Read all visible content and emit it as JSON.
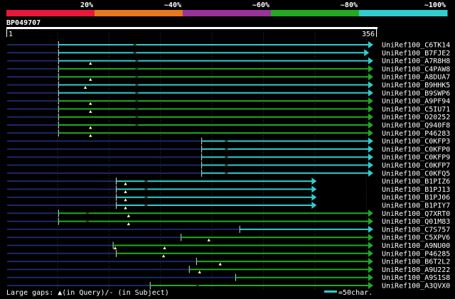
{
  "query_id": "BP049707",
  "legend_text": "Large gaps: ▲(in Query)/- (in Subject)",
  "scale_text": "=50char.",
  "colors": {
    "background": "#000000",
    "blue": "#33cccc",
    "green": "#22aa22",
    "navy": "#1a2a66",
    "red": "#e8183a",
    "orange": "#e8781e",
    "purple": "#993399"
  },
  "chart_data": {
    "type": "alignment",
    "query_start": 1,
    "query_end": 356,
    "identity_bands": [
      {
        "label": "20%",
        "color": "#e8183a"
      },
      {
        "label": "~40%",
        "color": "#e8781e"
      },
      {
        "label": "~60%",
        "color": "#993399"
      },
      {
        "label": "~80%",
        "color": "#22aa22"
      },
      {
        "label": "~100%",
        "color": "#33cccc"
      }
    ],
    "hits": [
      {
        "name": "UniRef100_C6TK14",
        "start": 51,
        "end": 356,
        "color": "blue",
        "marks": [
          {
            "pos": 125,
            "type": "gap_subject"
          }
        ]
      },
      {
        "name": "UniRef100_B7FJE2",
        "start": 51,
        "end": 352,
        "color": "blue",
        "marks": [
          {
            "pos": 125,
            "type": "gap_subject"
          }
        ]
      },
      {
        "name": "UniRef100_A7R8H8",
        "start": 51,
        "end": 356,
        "color": "blue",
        "marks": [
          {
            "pos": 82,
            "type": "gap_query"
          },
          {
            "pos": 127,
            "type": "gap_subject"
          }
        ]
      },
      {
        "name": "UniRef100_C4PAW8",
        "start": 51,
        "end": 356,
        "color": "green",
        "marks": [
          {
            "pos": 127,
            "type": "gap_subject"
          }
        ]
      },
      {
        "name": "UniRef100_A8DUA7",
        "start": 51,
        "end": 356,
        "color": "green",
        "marks": [
          {
            "pos": 82,
            "type": "gap_query"
          },
          {
            "pos": 127,
            "type": "gap_subject"
          }
        ]
      },
      {
        "name": "UniRef100_B9HHK5",
        "start": 51,
        "end": 356,
        "color": "blue",
        "marks": [
          {
            "pos": 77,
            "type": "gap_query"
          },
          {
            "pos": 127,
            "type": "gap_subject"
          }
        ]
      },
      {
        "name": "UniRef100_B9SWP6",
        "start": 51,
        "end": 356,
        "color": "blue",
        "marks": [
          {
            "pos": 127,
            "type": "gap_subject"
          }
        ]
      },
      {
        "name": "UniRef100_A9PF94",
        "start": 51,
        "end": 356,
        "color": "green",
        "marks": [
          {
            "pos": 82,
            "type": "gap_query"
          },
          {
            "pos": 127,
            "type": "gap_subject"
          }
        ]
      },
      {
        "name": "UniRef100_C5IU71",
        "start": 51,
        "end": 356,
        "color": "green",
        "marks": [
          {
            "pos": 82,
            "type": "gap_query"
          },
          {
            "pos": 127,
            "type": "gap_subject"
          }
        ]
      },
      {
        "name": "UniRef100_O20252",
        "start": 51,
        "end": 356,
        "color": "green",
        "marks": [
          {
            "pos": 127,
            "type": "gap_subject"
          }
        ]
      },
      {
        "name": "UniRef100_Q940F8",
        "start": 51,
        "end": 356,
        "color": "green",
        "marks": [
          {
            "pos": 82,
            "type": "gap_query"
          },
          {
            "pos": 127,
            "type": "gap_subject"
          }
        ]
      },
      {
        "name": "UniRef100_P46283",
        "start": 51,
        "end": 356,
        "color": "green",
        "marks": [
          {
            "pos": 82,
            "type": "gap_query"
          }
        ]
      },
      {
        "name": "UniRef100_C0KFP3",
        "start": 190,
        "end": 356,
        "color": "blue",
        "marks": [
          {
            "pos": 214,
            "type": "gap_subject"
          }
        ]
      },
      {
        "name": "UniRef100_C0KFP0",
        "start": 190,
        "end": 356,
        "color": "blue",
        "marks": [
          {
            "pos": 214,
            "type": "gap_subject"
          }
        ]
      },
      {
        "name": "UniRef100_C0KFP9",
        "start": 190,
        "end": 356,
        "color": "blue",
        "marks": [
          {
            "pos": 214,
            "type": "gap_subject"
          }
        ]
      },
      {
        "name": "UniRef100_C0KFP7",
        "start": 190,
        "end": 356,
        "color": "blue",
        "marks": [
          {
            "pos": 214,
            "type": "gap_subject"
          }
        ]
      },
      {
        "name": "UniRef100_C0KFQ5",
        "start": 190,
        "end": 356,
        "color": "blue",
        "marks": [
          {
            "pos": 214,
            "type": "gap_subject"
          }
        ]
      },
      {
        "name": "UniRef100_B1PIZ6",
        "start": 107,
        "end": 301,
        "color": "blue",
        "marks": [
          {
            "pos": 116,
            "type": "gap_query"
          },
          {
            "pos": 136,
            "type": "gap_subject"
          }
        ]
      },
      {
        "name": "UniRef100_B1PJ13",
        "start": 107,
        "end": 301,
        "color": "blue",
        "marks": [
          {
            "pos": 116,
            "type": "gap_query"
          },
          {
            "pos": 136,
            "type": "gap_subject"
          }
        ]
      },
      {
        "name": "UniRef100_B1PJ06",
        "start": 107,
        "end": 301,
        "color": "blue",
        "marks": [
          {
            "pos": 116,
            "type": "gap_query"
          },
          {
            "pos": 136,
            "type": "gap_subject"
          }
        ]
      },
      {
        "name": "UniRef100_B1PIY7",
        "start": 107,
        "end": 301,
        "color": "blue",
        "marks": [
          {
            "pos": 116,
            "type": "gap_query"
          },
          {
            "pos": 136,
            "type": "gap_subject"
          }
        ]
      },
      {
        "name": "UniRef100_Q7XRT0",
        "start": 51,
        "end": 356,
        "color": "green",
        "marks": [
          {
            "pos": 79,
            "type": "gap_subject"
          },
          {
            "pos": 119,
            "type": "gap_query"
          }
        ]
      },
      {
        "name": "UniRef100_Q01M83",
        "start": 51,
        "end": 356,
        "color": "green",
        "marks": [
          {
            "pos": 79,
            "type": "gap_subject"
          },
          {
            "pos": 119,
            "type": "gap_query"
          }
        ]
      },
      {
        "name": "UniRef100_C7S757",
        "start": 227,
        "end": 356,
        "color": "blue",
        "marks": []
      },
      {
        "name": "UniRef100_C5XPV6",
        "start": 170,
        "end": 356,
        "color": "green",
        "marks": [
          {
            "pos": 197,
            "type": "gap_query"
          }
        ]
      },
      {
        "name": "UniRef100_A9NU00",
        "start": 104,
        "end": 356,
        "color": "green",
        "marks": [
          {
            "pos": 106,
            "type": "gap_query"
          },
          {
            "pos": 154,
            "type": "gap_query"
          }
        ]
      },
      {
        "name": "UniRef100_P46285",
        "start": 107,
        "end": 356,
        "color": "green",
        "marks": [
          {
            "pos": 153,
            "type": "gap_query"
          }
        ]
      },
      {
        "name": "UniRef100_B6T2L2",
        "start": 185,
        "end": 356,
        "color": "green",
        "marks": [
          {
            "pos": 208,
            "type": "gap_query"
          }
        ]
      },
      {
        "name": "UniRef100_A9U222",
        "start": 178,
        "end": 356,
        "color": "green",
        "marks": [
          {
            "pos": 188,
            "type": "gap_query"
          }
        ]
      },
      {
        "name": "UniRef100_A9S1S8",
        "start": 223,
        "end": 356,
        "color": "green",
        "marks": []
      },
      {
        "name": "UniRef100_A3QVX0",
        "start": 140,
        "end": 356,
        "color": "green",
        "marks": [
          {
            "pos": 186,
            "type": "gap_subject"
          }
        ]
      }
    ]
  }
}
